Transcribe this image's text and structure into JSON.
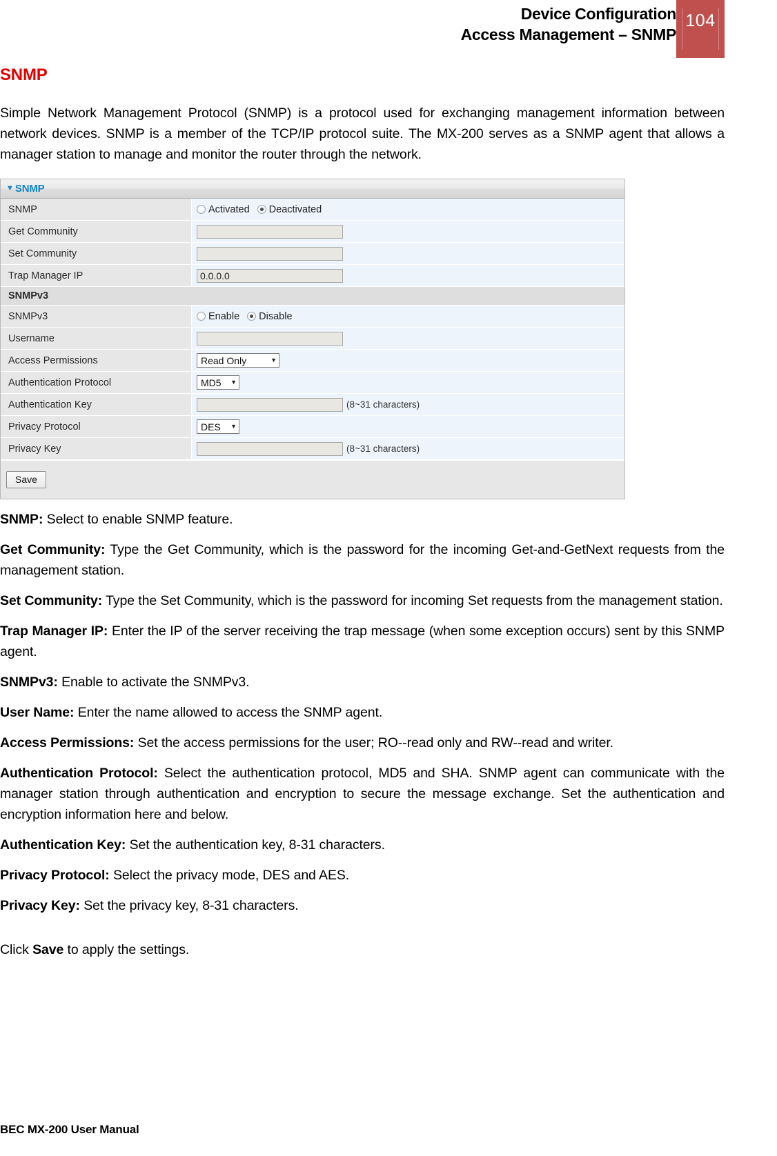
{
  "header": {
    "title_line1": "Device Configuration",
    "title_line2": "Access Management – SNMP",
    "page_number": "104",
    "accent_color": "#c0504d"
  },
  "section": {
    "title": "SNMP",
    "title_color": "#e00000",
    "intro": "Simple Network Management Protocol (SNMP) is a protocol used for exchanging management information between network devices. SNMP is a member of the TCP/IP protocol suite. The MX-200 serves as a SNMP agent that allows a manager station to manage and monitor the router through the network."
  },
  "panel": {
    "title": "SNMP",
    "title_color": "#1184c4",
    "caret_icon": "▼",
    "rows": [
      {
        "label": "SNMP",
        "type": "radio",
        "options": [
          {
            "label": "Activated",
            "checked": false
          },
          {
            "label": "Deactivated",
            "checked": true
          }
        ]
      },
      {
        "label": "Get Community",
        "type": "text",
        "value": ""
      },
      {
        "label": "Set Community",
        "type": "text",
        "value": ""
      },
      {
        "label": "Trap Manager IP",
        "type": "text",
        "value": "0.0.0.0"
      }
    ],
    "section_header": "SNMPv3",
    "rows_v3": [
      {
        "label": "SNMPv3",
        "type": "radio",
        "options": [
          {
            "label": "Enable",
            "checked": false
          },
          {
            "label": "Disable",
            "checked": true
          }
        ]
      },
      {
        "label": "Username",
        "type": "text",
        "value": ""
      },
      {
        "label": "Access Permissions",
        "type": "select",
        "value": "Read Only",
        "width": "wide"
      },
      {
        "label": "Authentication Protocol",
        "type": "select",
        "value": "MD5",
        "width": "narrow"
      },
      {
        "label": "Authentication Key",
        "type": "text",
        "value": "",
        "hint": "(8~31 characters)"
      },
      {
        "label": "Privacy Protocol",
        "type": "select",
        "value": "DES",
        "width": "narrow"
      },
      {
        "label": "Privacy Key",
        "type": "text",
        "value": "",
        "hint": "(8~31 characters)"
      }
    ],
    "save_label": "Save",
    "select_caret_icon": "▼"
  },
  "descriptions": [
    {
      "term": "SNMP:",
      "text": " Select to enable SNMP feature."
    },
    {
      "term": "Get Community:",
      "text": " Type the Get Community, which is the password for the incoming Get-and-GetNext requests from the management station."
    },
    {
      "term": "Set Community:",
      "text": " Type the Set Community, which is the password for incoming Set requests from the management station."
    },
    {
      "term": "Trap Manager IP:",
      "text": " Enter the IP of the server receiving the trap message (when some exception occurs) sent by this SNMP agent."
    },
    {
      "term": "SNMPv3:",
      "text": " Enable to activate the SNMPv3."
    },
    {
      "term": "User Name:",
      "text": " Enter the name allowed to access the SNMP agent."
    },
    {
      "term": "Access Permissions:",
      "text": " Set the access permissions for the user; RO--read only and RW--read and writer."
    },
    {
      "term": "Authentication Protocol:",
      "text": " Select the authentication protocol, MD5 and SHA. SNMP agent can communicate with the manager station through authentication and encryption to secure the message exchange. Set the authentication and encryption information here and below."
    },
    {
      "term": "Authentication Key:",
      "text": " Set the authentication key, 8-31 characters."
    },
    {
      "term": "Privacy Protocol:",
      "text": " Select the privacy mode, DES and AES."
    },
    {
      "term": "Privacy Key:",
      "text": " Set the privacy key, 8-31 characters."
    }
  ],
  "closing": {
    "prefix": "Click ",
    "bold": "Save",
    "suffix": " to apply the settings."
  },
  "footer": {
    "text": "BEC MX-200 User Manual"
  }
}
